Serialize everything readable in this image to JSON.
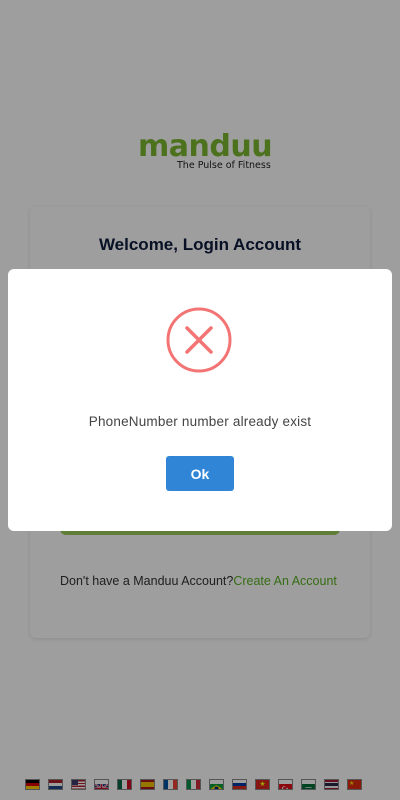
{
  "brand": {
    "name": "manduu",
    "tagline": "The Pulse of Fitness"
  },
  "login_card": {
    "title": "Welcome, Login Account",
    "signup_prompt": "Don't have a Manduu Account?",
    "signup_link": "Create An Account"
  },
  "dialog": {
    "icon": "error-x-icon",
    "message": "PhoneNumber number already exist",
    "ok_label": "Ok",
    "icon_color": "#f27474",
    "button_color": "#3085d6"
  },
  "languages": [
    {
      "name": "german-flag-icon"
    },
    {
      "name": "dutch-flag-icon"
    },
    {
      "name": "us-flag-icon"
    },
    {
      "name": "uk-flag-icon"
    },
    {
      "name": "mexico-flag-icon"
    },
    {
      "name": "spain-flag-icon"
    },
    {
      "name": "france-flag-icon"
    },
    {
      "name": "italy-flag-icon"
    },
    {
      "name": "brazil-flag-icon"
    },
    {
      "name": "russia-flag-icon"
    },
    {
      "name": "vietnam-flag-icon"
    },
    {
      "name": "turkey-flag-icon"
    },
    {
      "name": "saudi-arabia-flag-icon"
    },
    {
      "name": "thailand-flag-icon"
    },
    {
      "name": "china-flag-icon"
    }
  ]
}
